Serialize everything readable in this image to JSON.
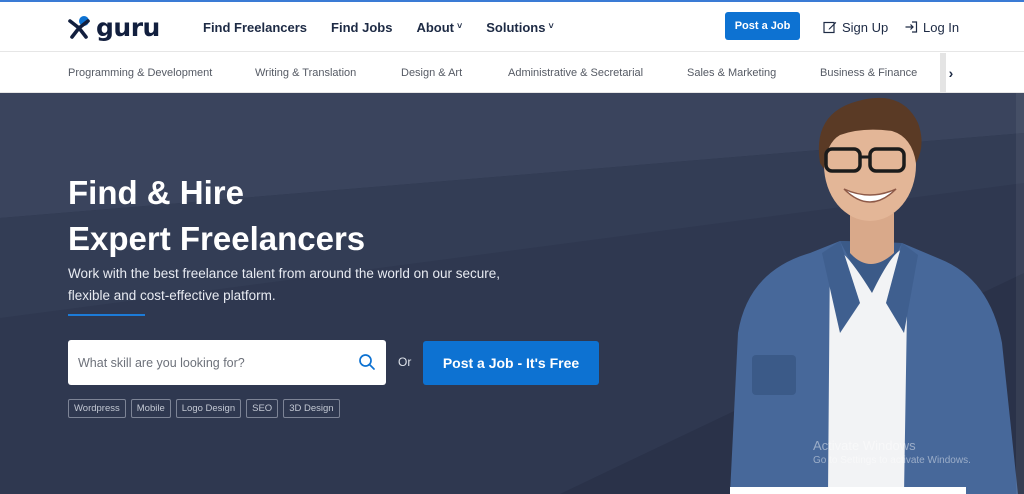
{
  "brand": {
    "name": "guru"
  },
  "nav": {
    "items": [
      {
        "label": "Find Freelancers",
        "dropdown": false
      },
      {
        "label": "Find Jobs",
        "dropdown": false
      },
      {
        "label": "About",
        "dropdown": true
      },
      {
        "label": "Solutions",
        "dropdown": true
      }
    ],
    "chevron": "˅"
  },
  "header": {
    "post_job_label": "Post a Job",
    "signup_label": "Sign Up",
    "login_label": "Log In",
    "accent_color": "#0d72d2"
  },
  "categories": {
    "items": [
      "Programming & Development",
      "Writing & Translation",
      "Design & Art",
      "Administrative & Secretarial",
      "Sales & Marketing",
      "Business & Finance"
    ],
    "next_arrow": "›"
  },
  "hero": {
    "title_line1": "Find & Hire",
    "title_line2": "Expert Freelancers",
    "subtitle": "Work with the best freelance talent from around the world on our secure, flexible and cost-effective platform.",
    "search_placeholder": "What skill are you looking for?",
    "or_label": "Or",
    "cta_label": "Post a Job - It's Free",
    "tags": [
      "Wordpress",
      "Mobile",
      "Logo Design",
      "SEO",
      "3D Design"
    ],
    "background_color": "#2f3850"
  },
  "os_watermark": {
    "title": "Activate Windows",
    "subtitle": "Go to Settings to activate Windows."
  }
}
